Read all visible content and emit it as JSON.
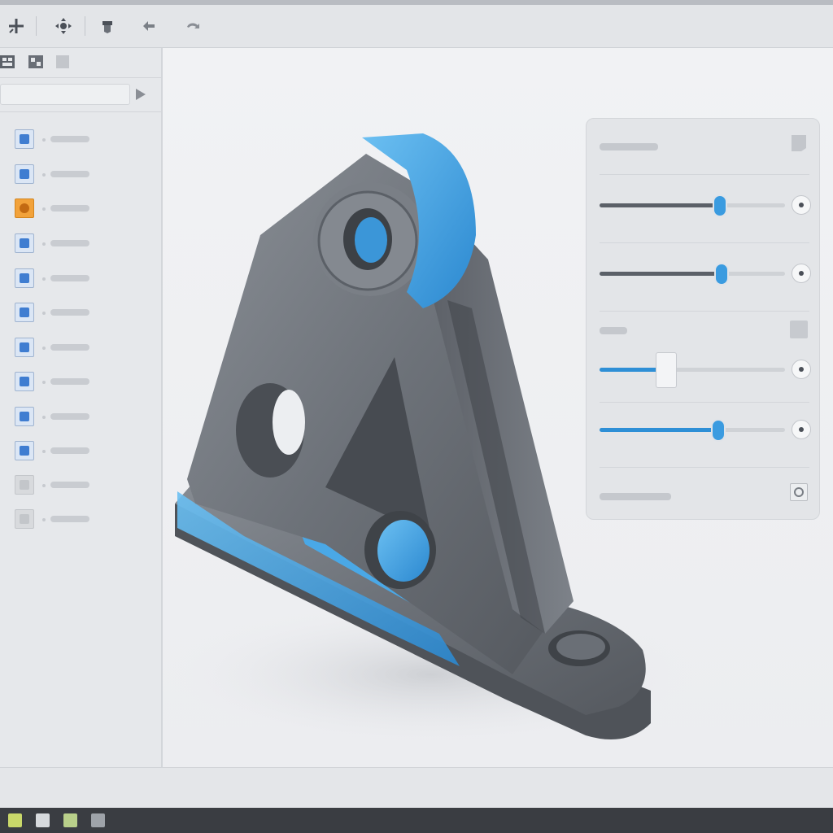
{
  "toolbar": {
    "tools": [
      {
        "icon": "move-icon"
      },
      {
        "icon": "pan-icon"
      },
      {
        "icon": "part-icon"
      },
      {
        "icon": "undo-icon"
      },
      {
        "icon": "redo-icon"
      }
    ]
  },
  "left_panel": {
    "tabs": [
      {
        "icon": "feature-tree-tab-icon"
      },
      {
        "icon": "property-tab-icon"
      },
      {
        "icon": "config-tab-icon"
      }
    ],
    "search": {
      "value": "",
      "placeholder": ""
    },
    "tree_items": [
      {
        "icon": "assembly-icon",
        "label": ""
      },
      {
        "icon": "sketch-icon",
        "label": ""
      },
      {
        "icon": "hole-feature-icon",
        "label": "",
        "highlighted": true
      },
      {
        "icon": "extrude-icon",
        "label": ""
      },
      {
        "icon": "cut-icon",
        "label": ""
      },
      {
        "icon": "fillet-icon",
        "label": ""
      },
      {
        "icon": "chamfer-icon",
        "label": ""
      },
      {
        "icon": "plane-icon",
        "label": ""
      },
      {
        "icon": "pattern-icon",
        "label": ""
      },
      {
        "icon": "revolve-icon",
        "label": ""
      },
      {
        "icon": "suppressed-icon",
        "label": ""
      },
      {
        "icon": "body-icon",
        "label": ""
      }
    ]
  },
  "properties": {
    "title": "",
    "section_label": "",
    "footer_label": "",
    "sliders": [
      {
        "value": 0.65,
        "color": "#5b6068"
      },
      {
        "value": 0.66,
        "color": "#5b6068"
      },
      {
        "value": 0.36,
        "color": "#2e8fd6",
        "handle": "square"
      },
      {
        "value": 0.64,
        "color": "#2e8fd6"
      }
    ]
  },
  "colors": {
    "accent": "#2e8fd6",
    "metal": "#6f747b",
    "highlight_orange": "#f2a23a"
  }
}
